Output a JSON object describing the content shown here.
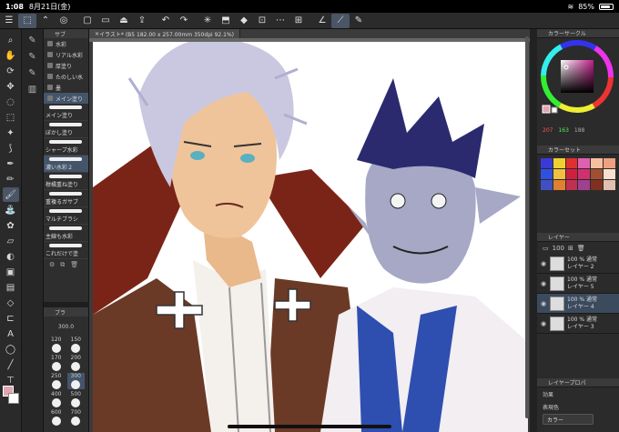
{
  "status": {
    "time": "1:08",
    "date": "8月21日(金)",
    "battery": "85%",
    "battery_fraction": 0.85
  },
  "command_bar": {
    "icons": [
      "menu-icon",
      "select-tool-icon",
      "chevron-icon",
      "gift-icon",
      "new-file-icon",
      "open-file-icon",
      "save-icon",
      "export-icon",
      "undo-icon",
      "redo-icon",
      "clear-icon",
      "transform-icon",
      "fill-icon",
      "clear-selection-icon",
      "snap-icon",
      "ruler-icon",
      "brush-mode-icon",
      "pen-mode-icon"
    ]
  },
  "tools": [
    "magnifier-icon",
    "hand-icon",
    "rotate-icon",
    "move-icon",
    "lasso-icon",
    "selection-icon",
    "wand-icon",
    "eyedropper-icon",
    "pen-icon",
    "pencil-icon",
    "brush-icon",
    "airbrush-icon",
    "decoration-icon",
    "eraser-icon",
    "blend-icon",
    "fill-icon",
    "gradient-icon",
    "figure-icon",
    "frame-icon",
    "text-icon",
    "balloon-icon",
    "line-icon",
    "correct-icon"
  ],
  "colors": {
    "foreground": "#e0a6b2",
    "background": "#ffffff"
  },
  "brush_panel": {
    "header": "サブ",
    "groups": [
      "水彩",
      "リアル水彩",
      "厚塗り",
      "たのしい水",
      "墨"
    ],
    "active_group": "メイン塗り",
    "brushes": [
      "メイン塗り",
      "ぼかし塗り",
      "シャープ水彩",
      "濃い水彩２",
      "柑橘重ね塗り",
      "重複るガサブ",
      "マルチブラシ",
      "主線も水彩",
      "これだけで塗"
    ]
  },
  "size_panel": {
    "header": "ブラ",
    "value": "300.0",
    "sizes": [
      "120",
      "150",
      "170",
      "200",
      "250",
      "300",
      "400",
      "500",
      "600",
      "700"
    ]
  },
  "canvas": {
    "tab_title": "イラスト* (B5 182.00 x 257.00mm 350dpi 92.1%)"
  },
  "color_circle": {
    "header": "カラーサークル",
    "r": "207",
    "g": "163",
    "b": "188"
  },
  "color_set": {
    "header": "カラーセット",
    "swatches": [
      "#3a3ad8",
      "#f0d030",
      "#e03030",
      "#e060b0",
      "#f5c0a0",
      "#f0a080",
      "#3050e0",
      "#f0c040",
      "#d02040",
      "#d03070",
      "#a05030",
      "#f8e0d0",
      "#4050c0",
      "#e08030",
      "#c03050",
      "#a04090",
      "#803020",
      "#e0c0b0"
    ]
  },
  "layers": {
    "header": "レイヤー",
    "opacity": "100",
    "items": [
      {
        "opacity": "100 %",
        "mode": "通常",
        "name": "レイヤー 2"
      },
      {
        "opacity": "100 %",
        "mode": "通常",
        "name": "レイヤー 5"
      },
      {
        "opacity": "100 %",
        "mode": "通常",
        "name": "レイヤー 4"
      },
      {
        "opacity": "100 %",
        "mode": "通常",
        "name": "レイヤー 3"
      }
    ]
  },
  "layer_property": {
    "header": "レイヤープロパ",
    "effect_label": "効果",
    "blend_label": "表現色",
    "blend_value": "カラー"
  }
}
